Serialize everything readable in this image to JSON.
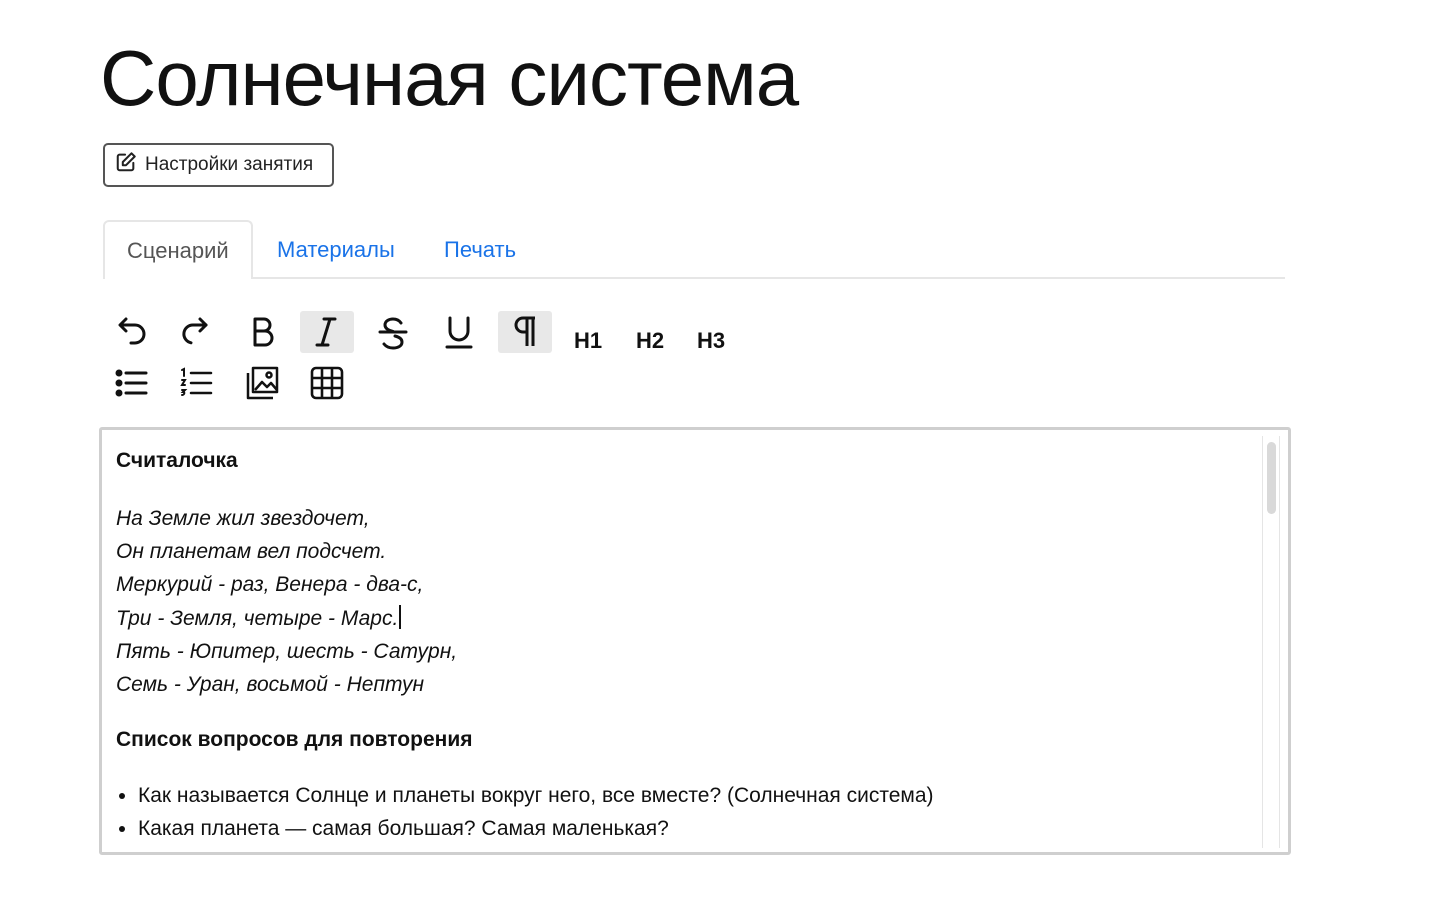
{
  "page": {
    "title": "Солнечная система"
  },
  "settings_button": {
    "label": "Настройки занятия",
    "icon": "edit-icon"
  },
  "tabs": [
    {
      "label": "Сценарий",
      "active": true
    },
    {
      "label": "Материалы",
      "active": false
    },
    {
      "label": "Печать",
      "active": false
    }
  ],
  "toolbar": {
    "buttons": [
      {
        "name": "undo",
        "icon": "undo-icon"
      },
      {
        "name": "redo",
        "icon": "redo-icon"
      },
      {
        "name": "bold",
        "icon": "bold-icon"
      },
      {
        "name": "italic",
        "icon": "italic-icon",
        "active": true
      },
      {
        "name": "strikethrough",
        "icon": "strikethrough-icon"
      },
      {
        "name": "underline",
        "icon": "underline-icon"
      },
      {
        "name": "paragraph",
        "icon": "paragraph-icon",
        "active": true
      },
      {
        "name": "bullet-list",
        "icon": "bullet-list-icon"
      },
      {
        "name": "numbered-list",
        "icon": "numbered-list-icon"
      },
      {
        "name": "image",
        "icon": "image-icon"
      },
      {
        "name": "table",
        "icon": "table-icon"
      }
    ],
    "h1": "H1",
    "h2": "H2",
    "h3": "H3"
  },
  "editor": {
    "heading1": "Считалочка",
    "poem": [
      "На Земле жил звездочет,",
      "Он планетам вел подсчет.",
      "Меркурий - раз, Венера - два-с,",
      "Три - Земля, четыре - Марс.",
      "Пять - Юпитер, шесть - Сатурн,",
      "Семь - Уран, восьмой - Нептун"
    ],
    "heading2": "Список вопросов для повторения",
    "questions": [
      "Как называется Солнце и планеты вокруг него, все вместе? (Солнечная система)",
      "Какая планета — самая большая? Самая маленькая?"
    ]
  },
  "colors": {
    "link": "#1a73e8",
    "active_button_bg": "#e8e8e8",
    "border": "#cfcfcf"
  }
}
